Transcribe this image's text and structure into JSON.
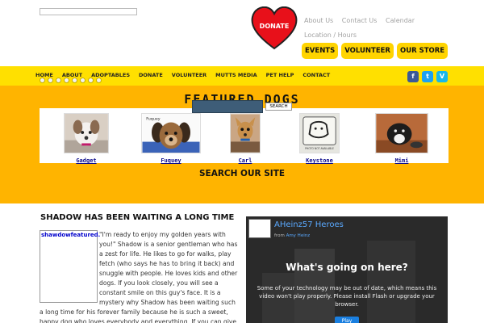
{
  "header": {
    "donate_label": "DONATE",
    "top_links": [
      "About Us",
      "Contact Us",
      "Calendar"
    ],
    "top_links_row2": "Location / Hours",
    "pill_buttons": [
      "EVENTS",
      "VOLUNTEER",
      "OUR STORE"
    ]
  },
  "nav": {
    "items": [
      "HOME",
      "ABOUT",
      "ADOPTABLES",
      "DONATE",
      "VOLUNTEER",
      "MUTTS MEDIA",
      "PET HELP",
      "CONTACT"
    ],
    "social": [
      "f",
      "t",
      "V"
    ]
  },
  "featured": {
    "title": "FEATURED DOGS",
    "dogs": [
      {
        "name": "Gadget"
      },
      {
        "name": "Fuquey",
        "caption": "Fuquey"
      },
      {
        "name": "Carl"
      },
      {
        "name": "Keystone",
        "caption": "PHOTO NOT AVAILABLE"
      },
      {
        "name": "Mimi"
      }
    ],
    "search_title": "SEARCH OUR SITE",
    "search_button": "SEARCH"
  },
  "post": {
    "title": "SHADOW HAS BEEN WAITING A LONG TIME",
    "image_alt": "shawdowfeatured.",
    "body": "\"I'm ready to enjoy my golden years with you!\" Shadow is a senior gentleman who has a zest for life.  He likes to go for walks, play fetch (who says he has to bring it back) and snuggle with people.  He loves kids and other dogs. If you look closely, you will see a constant smile on this guy's face. It is a mystery why Shadow has been waiting such a long time for his forever family because he is such a sweet, happy dog who loves everybody and everything.  If you can give him a family, you can"
  },
  "video": {
    "channel_title": "AHeinz57 Heroes",
    "from_label": "from",
    "from_user": "Amy Heinz",
    "heading": "What's going on here?",
    "message": "Some of your technology may be out of date, which means this video won't play properly. Please install Flash or upgrade your browser.",
    "play_label": "Play"
  },
  "colors": {
    "nav_yellow": "#ffe000",
    "featured_orange": "#ffb400",
    "heart_red": "#e8101a",
    "link_blue": "#0a0a8a"
  }
}
